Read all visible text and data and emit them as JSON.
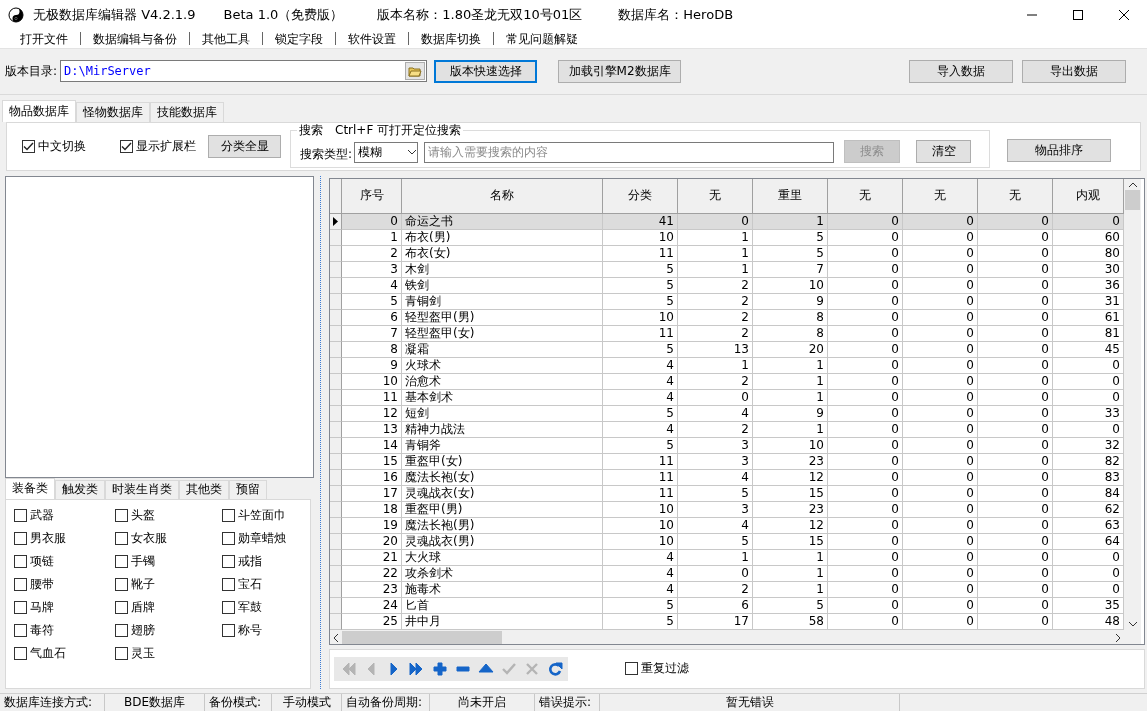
{
  "window": {
    "title": "无极数据库编辑器 V4.2.1.9",
    "edition": "Beta 1.0（免费版）",
    "version_name": "版本名称：1.80圣龙无双10号01区",
    "db_name": "数据库名：HeroDB"
  },
  "menu": [
    "打开文件",
    "数据编辑与备份",
    "其他工具",
    "锁定字段",
    "软件设置",
    "数据库切换",
    "常见问题解疑"
  ],
  "toolbar": {
    "dir_label": "版本目录:",
    "dir_value": "D:\\MirServer",
    "buttons": [
      {
        "label": "版本快速选择",
        "focused": true
      },
      {
        "label": "加载引擎M2数据库",
        "focused": false
      },
      {
        "label": "导入数据",
        "focused": false
      },
      {
        "label": "导出数据",
        "focused": false
      }
    ]
  },
  "tabs": [
    {
      "label": "物品数据库",
      "selected": true
    },
    {
      "label": "怪物数据库",
      "selected": false
    },
    {
      "label": "技能数据库",
      "selected": false
    }
  ],
  "filter_bar": {
    "checks": [
      {
        "label": "中文切换",
        "checked": true
      },
      {
        "label": "显示扩展栏",
        "checked": true
      }
    ],
    "show_all_button": "分类全显",
    "search": {
      "title": "搜索　Ctrl+F 可打开定位搜索",
      "type_label": "搜索类型:",
      "type_value": "模糊",
      "placeholder": "请输入需要搜索的内容",
      "search_button": {
        "label": "搜索",
        "disabled": true
      },
      "clear_button": "清空"
    },
    "sort_button": "物品排序"
  },
  "category_tabs": [
    {
      "label": "装备类",
      "selected": true
    },
    {
      "label": "触发类",
      "selected": false
    },
    {
      "label": "时装生肖类",
      "selected": false
    },
    {
      "label": "其他类",
      "selected": false
    },
    {
      "label": "预留",
      "selected": false
    }
  ],
  "categories": [
    {
      "label": "武器",
      "checked": false
    },
    {
      "label": "头盔",
      "checked": false
    },
    {
      "label": "斗笠面巾",
      "checked": false
    },
    {
      "label": "男衣服",
      "checked": false
    },
    {
      "label": "女衣服",
      "checked": false
    },
    {
      "label": "勋章蜡烛",
      "checked": false
    },
    {
      "label": "项链",
      "checked": false
    },
    {
      "label": "手镯",
      "checked": false
    },
    {
      "label": "戒指",
      "checked": false
    },
    {
      "label": "腰带",
      "checked": false
    },
    {
      "label": "靴子",
      "checked": false
    },
    {
      "label": "宝石",
      "checked": false
    },
    {
      "label": "马牌",
      "checked": false
    },
    {
      "label": "盾牌",
      "checked": false
    },
    {
      "label": "军鼓",
      "checked": false
    },
    {
      "label": "毒符",
      "checked": false
    },
    {
      "label": "翅膀",
      "checked": false
    },
    {
      "label": "称号",
      "checked": false
    },
    {
      "label": "气血石",
      "checked": false
    },
    {
      "label": "灵玉",
      "checked": false
    }
  ],
  "grid": {
    "columns": [
      "序号",
      "名称",
      "分类",
      "无",
      "重里",
      "无",
      "无",
      "无",
      "内观"
    ],
    "rows": [
      {
        "cells": [
          "0",
          "命运之书",
          "41",
          "0",
          "1",
          "0",
          "0",
          "0",
          "0"
        ],
        "selected": true
      },
      {
        "cells": [
          "1",
          "布衣(男)",
          "10",
          "1",
          "5",
          "0",
          "0",
          "0",
          "60"
        ],
        "selected": false
      },
      {
        "cells": [
          "2",
          "布衣(女)",
          "11",
          "1",
          "5",
          "0",
          "0",
          "0",
          "80"
        ],
        "selected": false
      },
      {
        "cells": [
          "3",
          "木剑",
          "5",
          "1",
          "7",
          "0",
          "0",
          "0",
          "30"
        ],
        "selected": false
      },
      {
        "cells": [
          "4",
          "铁剑",
          "5",
          "2",
          "10",
          "0",
          "0",
          "0",
          "36"
        ],
        "selected": false
      },
      {
        "cells": [
          "5",
          "青铜剑",
          "5",
          "2",
          "9",
          "0",
          "0",
          "0",
          "31"
        ],
        "selected": false
      },
      {
        "cells": [
          "6",
          "轻型盔甲(男)",
          "10",
          "2",
          "8",
          "0",
          "0",
          "0",
          "61"
        ],
        "selected": false
      },
      {
        "cells": [
          "7",
          "轻型盔甲(女)",
          "11",
          "2",
          "8",
          "0",
          "0",
          "0",
          "81"
        ],
        "selected": false
      },
      {
        "cells": [
          "8",
          "凝霜",
          "5",
          "13",
          "20",
          "0",
          "0",
          "0",
          "45"
        ],
        "selected": false
      },
      {
        "cells": [
          "9",
          "火球术",
          "4",
          "1",
          "1",
          "0",
          "0",
          "0",
          "0"
        ],
        "selected": false
      },
      {
        "cells": [
          "10",
          "治愈术",
          "4",
          "2",
          "1",
          "0",
          "0",
          "0",
          "0"
        ],
        "selected": false
      },
      {
        "cells": [
          "11",
          "基本剑术",
          "4",
          "0",
          "1",
          "0",
          "0",
          "0",
          "0"
        ],
        "selected": false
      },
      {
        "cells": [
          "12",
          "短剑",
          "5",
          "4",
          "9",
          "0",
          "0",
          "0",
          "33"
        ],
        "selected": false
      },
      {
        "cells": [
          "13",
          "精神力战法",
          "4",
          "2",
          "1",
          "0",
          "0",
          "0",
          "0"
        ],
        "selected": false
      },
      {
        "cells": [
          "14",
          "青铜斧",
          "5",
          "3",
          "10",
          "0",
          "0",
          "0",
          "32"
        ],
        "selected": false
      },
      {
        "cells": [
          "15",
          "重盔甲(女)",
          "11",
          "3",
          "23",
          "0",
          "0",
          "0",
          "82"
        ],
        "selected": false
      },
      {
        "cells": [
          "16",
          "魔法长袍(女)",
          "11",
          "4",
          "12",
          "0",
          "0",
          "0",
          "83"
        ],
        "selected": false
      },
      {
        "cells": [
          "17",
          "灵魂战衣(女)",
          "11",
          "5",
          "15",
          "0",
          "0",
          "0",
          "84"
        ],
        "selected": false
      },
      {
        "cells": [
          "18",
          "重盔甲(男)",
          "10",
          "3",
          "23",
          "0",
          "0",
          "0",
          "62"
        ],
        "selected": false
      },
      {
        "cells": [
          "19",
          "魔法长袍(男)",
          "10",
          "4",
          "12",
          "0",
          "0",
          "0",
          "63"
        ],
        "selected": false
      },
      {
        "cells": [
          "20",
          "灵魂战衣(男)",
          "10",
          "5",
          "15",
          "0",
          "0",
          "0",
          "64"
        ],
        "selected": false
      },
      {
        "cells": [
          "21",
          "大火球",
          "4",
          "1",
          "1",
          "0",
          "0",
          "0",
          "0"
        ],
        "selected": false
      },
      {
        "cells": [
          "22",
          "攻杀剑术",
          "4",
          "0",
          "1",
          "0",
          "0",
          "0",
          "0"
        ],
        "selected": false
      },
      {
        "cells": [
          "23",
          "施毒术",
          "4",
          "2",
          "1",
          "0",
          "0",
          "0",
          "0"
        ],
        "selected": false
      },
      {
        "cells": [
          "24",
          "匕首",
          "5",
          "6",
          "5",
          "0",
          "0",
          "0",
          "35"
        ],
        "selected": false
      },
      {
        "cells": [
          "25",
          "井中月",
          "5",
          "17",
          "58",
          "0",
          "0",
          "0",
          "48"
        ],
        "selected": false
      }
    ]
  },
  "nav_buttons": [
    {
      "kind": "first",
      "disabled": true
    },
    {
      "kind": "prior",
      "disabled": true
    },
    {
      "kind": "next",
      "disabled": false
    },
    {
      "kind": "last",
      "disabled": false
    },
    {
      "kind": "insert",
      "disabled": false
    },
    {
      "kind": "delete",
      "disabled": false
    },
    {
      "kind": "edit",
      "disabled": false
    },
    {
      "kind": "post",
      "disabled": true
    },
    {
      "kind": "cancel",
      "disabled": true
    },
    {
      "kind": "refresh",
      "disabled": false
    }
  ],
  "dup_filter": {
    "label": "重复过滤",
    "checked": false
  },
  "status_bar": [
    "数据库连接方式:",
    "BDE数据库",
    "备份模式:",
    "手动模式",
    "自动备份周期:",
    "尚未开启",
    "错误提示:",
    "暂无错误"
  ]
}
